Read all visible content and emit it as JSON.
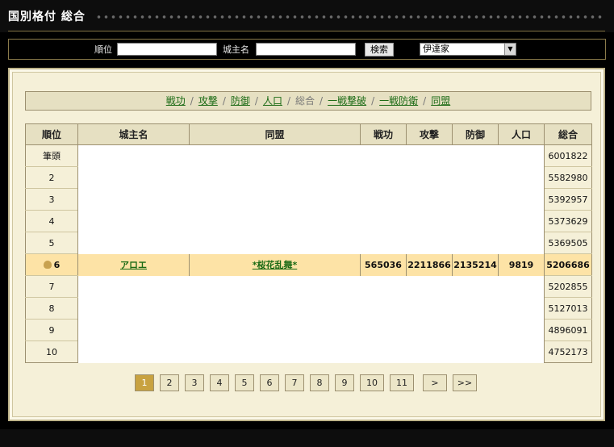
{
  "header": {
    "title": "国別格付 総合"
  },
  "search": {
    "rank_label": "順位",
    "rank_value": "",
    "name_label": "城主名",
    "name_value": "",
    "button_label": "検索",
    "house_selected": "伊達家"
  },
  "tabs": [
    "戦功",
    "攻撃",
    "防御",
    "人口",
    "総合",
    "一戦撃破",
    "一戦防衛",
    "同盟"
  ],
  "current_tab": "総合",
  "table": {
    "columns": [
      "順位",
      "城主名",
      "同盟",
      "戦功",
      "攻撃",
      "防御",
      "人口",
      "総合"
    ],
    "rows": [
      {
        "rank": "筆頭",
        "total": "6001822"
      },
      {
        "rank": "2",
        "total": "5582980"
      },
      {
        "rank": "3",
        "total": "5392957"
      },
      {
        "rank": "4",
        "total": "5373629"
      },
      {
        "rank": "5",
        "total": "5369505"
      },
      {
        "rank": "6",
        "name": "アロエ",
        "alliance": "*桜花乱舞*",
        "merit": "565036",
        "attack": "2211866",
        "defense": "2135214",
        "population": "9819",
        "total": "5206686",
        "highlight": true
      },
      {
        "rank": "7",
        "total": "5202855"
      },
      {
        "rank": "8",
        "total": "5127013"
      },
      {
        "rank": "9",
        "total": "4896091"
      },
      {
        "rank": "10",
        "total": "4752173"
      }
    ]
  },
  "pagination": {
    "pages": [
      "1",
      "2",
      "3",
      "4",
      "5",
      "6",
      "7",
      "8",
      "9",
      "10",
      "11"
    ],
    "current": "1",
    "next": ">",
    "last": ">>"
  },
  "colors": {
    "accent": "#c8a240",
    "highlight_row": "#fde3a6",
    "link": "#1a6a14",
    "panel": "#f5f0d8"
  }
}
